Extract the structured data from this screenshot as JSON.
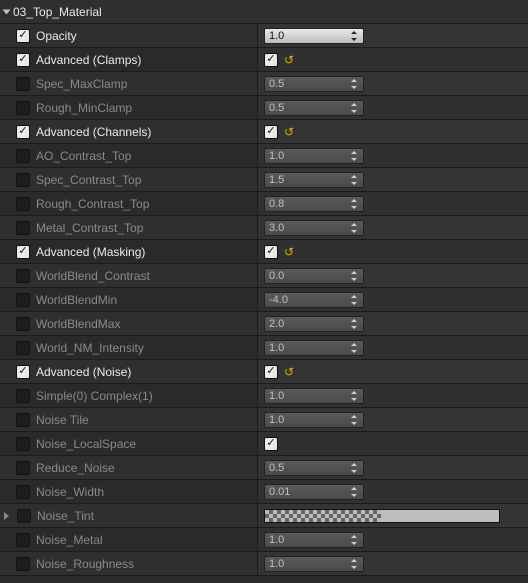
{
  "section": {
    "title": "03_Top_Material"
  },
  "rows": [
    {
      "id": "opacity",
      "label": "Opacity",
      "checked": true,
      "kind": "num",
      "value": "1.0",
      "lit": true
    },
    {
      "id": "adv-clamps",
      "label": "Advanced (Clamps)",
      "checked": true,
      "kind": "check",
      "value": true,
      "reset": true
    },
    {
      "id": "spec-maxclamp",
      "label": "Spec_MaxClamp",
      "checked": false,
      "kind": "num",
      "value": "0.5"
    },
    {
      "id": "rough-minclamp",
      "label": "Rough_MinClamp",
      "checked": false,
      "kind": "num",
      "value": "0.5"
    },
    {
      "id": "adv-channels",
      "label": "Advanced (Channels)",
      "checked": true,
      "kind": "check",
      "value": true,
      "reset": true
    },
    {
      "id": "ao-contrast",
      "label": "AO_Contrast_Top",
      "checked": false,
      "kind": "num",
      "value": "1.0"
    },
    {
      "id": "spec-contrast",
      "label": "Spec_Contrast_Top",
      "checked": false,
      "kind": "num",
      "value": "1.5"
    },
    {
      "id": "rough-contrast",
      "label": "Rough_Contrast_Top",
      "checked": false,
      "kind": "num",
      "value": "0.8"
    },
    {
      "id": "metal-contrast",
      "label": "Metal_Contrast_Top",
      "checked": false,
      "kind": "num",
      "value": "3.0"
    },
    {
      "id": "adv-masking",
      "label": "Advanced (Masking)",
      "checked": true,
      "kind": "check",
      "value": true,
      "reset": true
    },
    {
      "id": "wb-contrast",
      "label": "WorldBlend_Contrast",
      "checked": false,
      "kind": "num",
      "value": "0.0"
    },
    {
      "id": "wb-min",
      "label": "WorldBlendMin",
      "checked": false,
      "kind": "num",
      "value": "-4.0"
    },
    {
      "id": "wb-max",
      "label": "WorldBlendMax",
      "checked": false,
      "kind": "num",
      "value": "2.0"
    },
    {
      "id": "wnm-intensity",
      "label": "World_NM_Intensity",
      "checked": false,
      "kind": "num",
      "value": "1.0"
    },
    {
      "id": "adv-noise",
      "label": "Advanced (Noise)",
      "checked": true,
      "kind": "check",
      "value": true,
      "reset": true
    },
    {
      "id": "simple-complex",
      "label": "Simple(0) Complex(1)",
      "checked": false,
      "kind": "num",
      "value": "1.0"
    },
    {
      "id": "noise-tile",
      "label": "Noise Tile",
      "checked": false,
      "kind": "num",
      "value": "1.0"
    },
    {
      "id": "noise-local",
      "label": "Noise_LocalSpace",
      "checked": false,
      "kind": "check",
      "value": true
    },
    {
      "id": "reduce-noise",
      "label": "Reduce_Noise",
      "checked": false,
      "kind": "num",
      "value": "0.5"
    },
    {
      "id": "noise-width",
      "label": "Noise_Width",
      "checked": false,
      "kind": "num",
      "value": "0.01"
    },
    {
      "id": "noise-tint",
      "label": "Noise_Tint",
      "checked": false,
      "kind": "color",
      "expand": true
    },
    {
      "id": "noise-metal",
      "label": "Noise_Metal",
      "checked": false,
      "kind": "num",
      "value": "1.0"
    },
    {
      "id": "noise-rough",
      "label": "Noise_Roughness",
      "checked": false,
      "kind": "num",
      "value": "1.0"
    }
  ]
}
